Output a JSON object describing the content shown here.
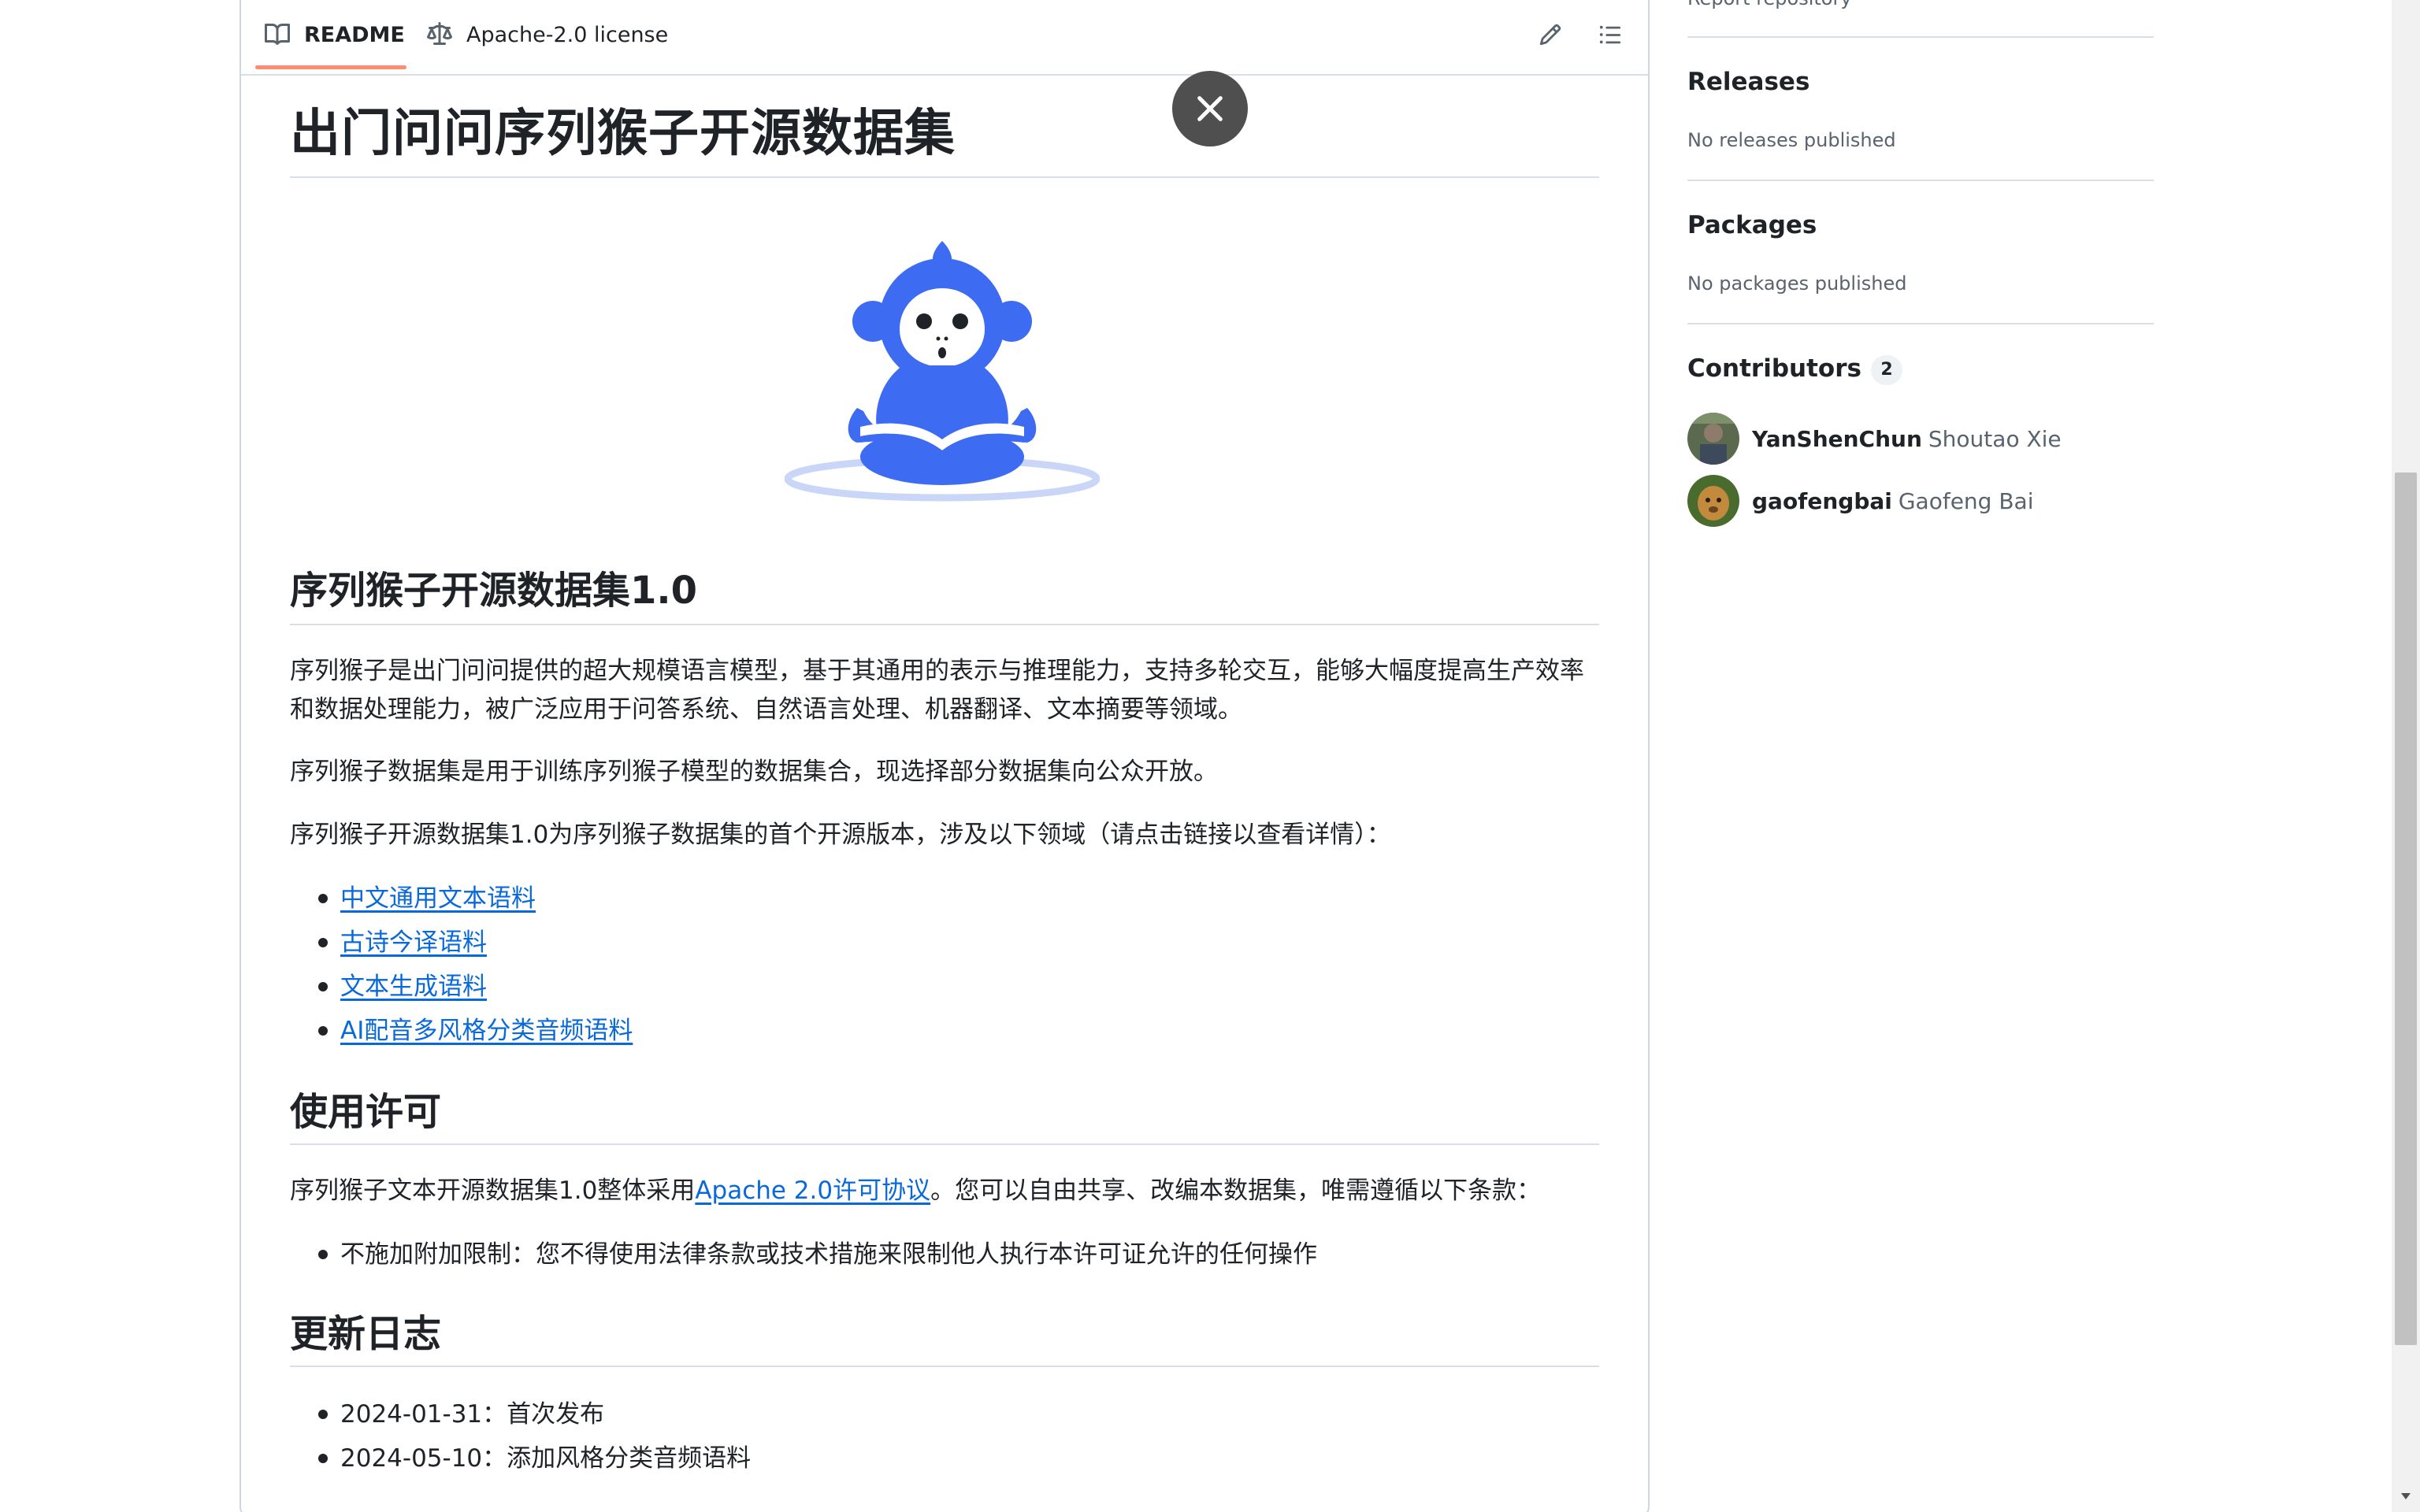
{
  "tabs": {
    "readme_label": "README",
    "license_label": "Apache-2.0 license"
  },
  "readme": {
    "title": "出门问问序列猴子开源数据集",
    "section1_heading": "序列猴子开源数据集1.0",
    "para1": "序列猴子是出门问问提供的超大规模语言模型，基于其通用的表示与推理能力，支持多轮交互，能够大幅度提高生产效率和数据处理能力，被广泛应用于问答系统、自然语言处理、机器翻译、文本摘要等领域。",
    "para2": "序列猴子数据集是用于训练序列猴子模型的数据集合，现选择部分数据集向公众开放。",
    "para3": "序列猴子开源数据集1.0为序列猴子数据集的首个开源版本，涉及以下领域（请点击链接以查看详情）：",
    "links": [
      "中文通用文本语料",
      "古诗今译语料",
      "文本生成语料",
      "AI配音多风格分类音频语料"
    ],
    "section2_heading": "使用许可",
    "license_pre": "序列猴子文本开源数据集1.0整体采用",
    "license_link": "Apache 2.0许可协议",
    "license_post": "。您可以自由共享、改编本数据集，唯需遵循以下条款：",
    "license_terms": [
      "不施加附加限制：您不得使用法律条款或技术措施来限制他人执行本许可证允许的任何操作"
    ],
    "section3_heading": "更新日志",
    "changelog": [
      "2024-01-31：首次发布",
      "2024-05-10：添加风格分类音频语料"
    ]
  },
  "sidebar": {
    "report_link": "Report repository",
    "releases_heading": "Releases",
    "releases_empty": "No releases published",
    "packages_heading": "Packages",
    "packages_empty": "No packages published",
    "contributors_heading": "Contributors",
    "contributors_count": "2",
    "contributors": [
      {
        "login": "YanShenChun",
        "name": "Shoutao Xie"
      },
      {
        "login": "gaofengbai",
        "name": "Gaofeng Bai"
      }
    ]
  },
  "colors": {
    "link": "#0969da",
    "tab_underline": "#fd8c73",
    "logo_blue": "#3d6cf2"
  },
  "icons": [
    "book-icon",
    "law-icon",
    "pencil-icon",
    "list-icon",
    "close-icon"
  ]
}
